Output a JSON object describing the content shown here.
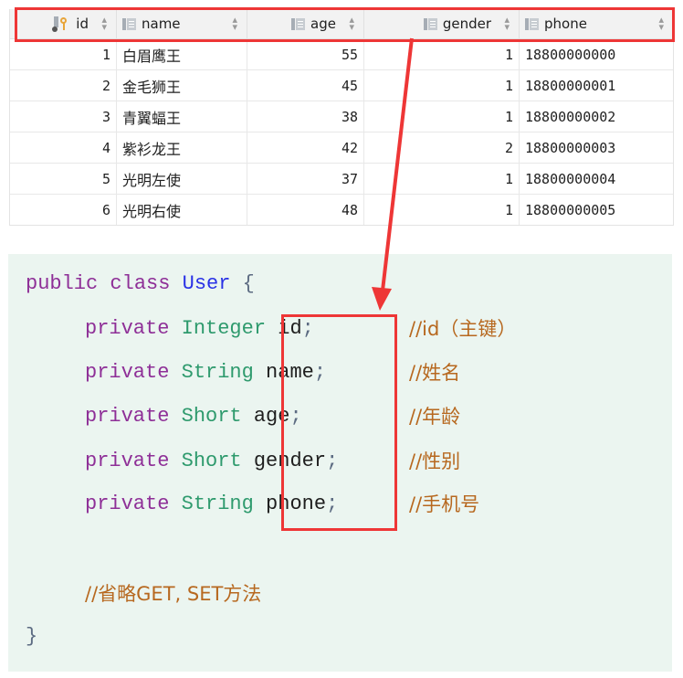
{
  "table": {
    "columns": [
      {
        "key": "id",
        "label": "id",
        "icon": "primary-key-column-icon",
        "align": "right"
      },
      {
        "key": "name",
        "label": "name",
        "icon": "column-icon",
        "align": "left"
      },
      {
        "key": "age",
        "label": "age",
        "icon": "column-icon",
        "align": "right"
      },
      {
        "key": "gender",
        "label": "gender",
        "icon": "column-icon",
        "align": "right"
      },
      {
        "key": "phone",
        "label": "phone",
        "icon": "column-icon",
        "align": "left"
      }
    ],
    "sort_glyph": "⇕",
    "rows": [
      {
        "id": "1",
        "name": "白眉鹰王",
        "age": "55",
        "gender": "1",
        "phone": "18800000000"
      },
      {
        "id": "2",
        "name": "金毛狮王",
        "age": "45",
        "gender": "1",
        "phone": "18800000001"
      },
      {
        "id": "3",
        "name": "青翼蝠王",
        "age": "38",
        "gender": "1",
        "phone": "18800000002"
      },
      {
        "id": "4",
        "name": "紫衫龙王",
        "age": "42",
        "gender": "2",
        "phone": "18800000003"
      },
      {
        "id": "5",
        "name": "光明左使",
        "age": "37",
        "gender": "1",
        "phone": "18800000004"
      },
      {
        "id": "6",
        "name": "光明右使",
        "age": "48",
        "gender": "1",
        "phone": "18800000005"
      }
    ]
  },
  "code": {
    "class_decl": {
      "kw1": "public",
      "kw2": "class",
      "name": "User",
      "brace": "{"
    },
    "fields": [
      {
        "mod": "private",
        "type": "Integer",
        "name": "id",
        "semi": ";",
        "comment": "//id（主键）"
      },
      {
        "mod": "private",
        "type": "String",
        "name": "name",
        "semi": ";",
        "comment": "//姓名"
      },
      {
        "mod": "private",
        "type": "Short",
        "name": "age",
        "semi": ";",
        "comment": "//年龄"
      },
      {
        "mod": "private",
        "type": "Short",
        "name": "gender",
        "semi": ";",
        "comment": "//性别"
      },
      {
        "mod": "private",
        "type": "String",
        "name": "phone",
        "semi": ";",
        "comment": "//手机号"
      }
    ],
    "omit_comment": "//省略GET, SET方法",
    "close_brace": "}"
  },
  "colors": {
    "highlight": "#ee3636",
    "keyword": "#8e2f97",
    "type": "#2e9a6d",
    "class_name": "#2a32e6",
    "comment": "#b7681f",
    "code_bg": "#ebf5f0",
    "header_bg": "#f2f2f2"
  }
}
